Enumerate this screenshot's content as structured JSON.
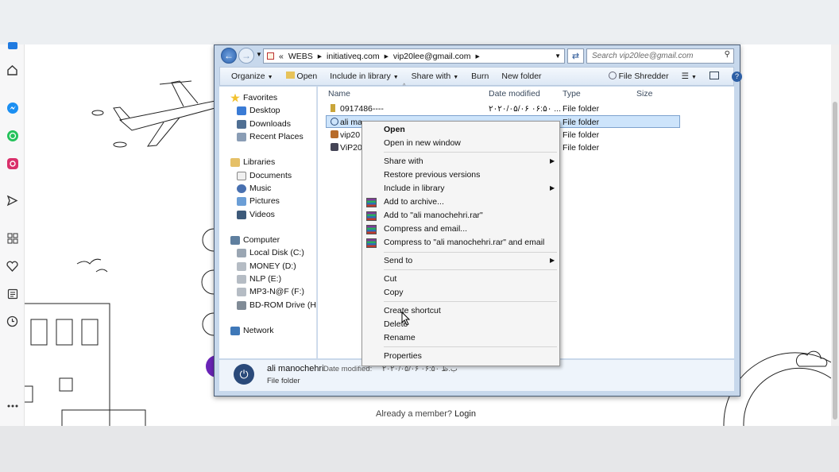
{
  "left_rail": {
    "icons": [
      "app-icon",
      "home-icon",
      "messenger-icon",
      "whatsapp-icon",
      "instagram-icon",
      "send-icon",
      "apps-icon",
      "heart-icon",
      "notes-icon",
      "clock-icon",
      "more-icon"
    ]
  },
  "page": {
    "member_text": "Already a member?",
    "login_link": "Login"
  },
  "explorer": {
    "address": {
      "prefix": "«",
      "crumbs": [
        "WEBS",
        "initiativeq.com",
        "vip20lee@gmail.com"
      ],
      "search_placeholder": "Search vip20lee@gmail.com"
    },
    "toolbar": {
      "organize": "Organize",
      "open": "Open",
      "include_in_library": "Include in library",
      "share_with": "Share with",
      "burn": "Burn",
      "new_folder": "New folder",
      "file_shredder": "File Shredder"
    },
    "nav": {
      "favorites": "Favorites",
      "desktop": "Desktop",
      "downloads": "Downloads",
      "recent_places": "Recent Places",
      "libraries": "Libraries",
      "documents": "Documents",
      "music": "Music",
      "pictures": "Pictures",
      "videos": "Videos",
      "computer": "Computer",
      "local_disk": "Local Disk (C:)",
      "money": "MONEY (D:)",
      "nlp": "NLP (E:)",
      "mp3": "MP3-N@F (F:)",
      "bdrom": "BD-ROM Drive (H:) F",
      "network": "Network"
    },
    "columns": {
      "name": "Name",
      "date_modified": "Date modified",
      "type": "Type",
      "size": "Size"
    },
    "rows": [
      {
        "name": "0917486----",
        "date": "۲۰۲۰/۰۵/۰۶ ۰۶:۵۰ ...",
        "type": "File folder"
      },
      {
        "name": "ali ma",
        "date": "",
        "type": "File folder"
      },
      {
        "name": "vip20",
        "date": "",
        "type": "File folder"
      },
      {
        "name": "ViP202",
        "date": "",
        "type": "File folder"
      }
    ],
    "details": {
      "name": "ali manochehri",
      "date_label": "Date modified:",
      "date_value": "۲۰۲۰/۰۵/۰۶ ب.ظ ۰۶:۵۰",
      "type": "File folder"
    }
  },
  "context_menu": {
    "open": "Open",
    "open_new_window": "Open in new window",
    "share_with": "Share with",
    "restore": "Restore previous versions",
    "include_in_library": "Include in library",
    "add_to_archive": "Add to archive...",
    "add_to_rar": "Add to \"ali manochehri.rar\"",
    "compress_email": "Compress and email...",
    "compress_rar_email": "Compress to \"ali manochehri.rar\" and email",
    "send_to": "Send to",
    "cut": "Cut",
    "copy": "Copy",
    "create_shortcut": "Create shortcut",
    "delete": "Delete",
    "rename": "Rename",
    "properties": "Properties"
  }
}
